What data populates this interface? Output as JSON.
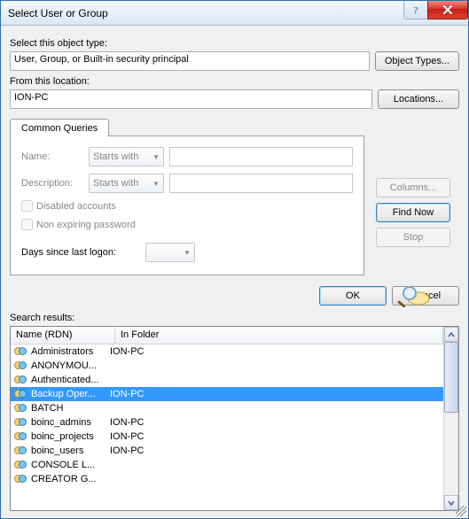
{
  "titlebar": {
    "title": "Select User or Group"
  },
  "object_type": {
    "label": "Select this object type:",
    "value": "User, Group, or Built-in security principal",
    "button": "Object Types..."
  },
  "location": {
    "label": "From this location:",
    "value": "ION-PC",
    "button": "Locations..."
  },
  "tab": {
    "label": "Common Queries",
    "name_label": "Name:",
    "description_label": "Description:",
    "name_mode": "Starts with",
    "desc_mode": "Starts with",
    "disabled_accounts": "Disabled accounts",
    "non_expiring": "Non expiring password",
    "days_since": "Days since last logon:"
  },
  "side": {
    "columns": "Columns...",
    "find": "Find Now",
    "stop": "Stop"
  },
  "dialog": {
    "ok": "OK",
    "cancel": "Cancel"
  },
  "results": {
    "label": "Search results:",
    "col_name": "Name (RDN)",
    "col_folder": "In Folder",
    "rows": [
      {
        "name": "Administrators",
        "folder": "ION-PC",
        "selected": false
      },
      {
        "name": "ANONYMOU...",
        "folder": "",
        "selected": false
      },
      {
        "name": "Authenticated...",
        "folder": "",
        "selected": false
      },
      {
        "name": "Backup Oper...",
        "folder": "ION-PC",
        "selected": true
      },
      {
        "name": "BATCH",
        "folder": "",
        "selected": false
      },
      {
        "name": "boinc_admins",
        "folder": "ION-PC",
        "selected": false
      },
      {
        "name": "boinc_projects",
        "folder": "ION-PC",
        "selected": false
      },
      {
        "name": "boinc_users",
        "folder": "ION-PC",
        "selected": false
      },
      {
        "name": "CONSOLE L...",
        "folder": "",
        "selected": false
      },
      {
        "name": "CREATOR G...",
        "folder": "",
        "selected": false
      }
    ]
  }
}
